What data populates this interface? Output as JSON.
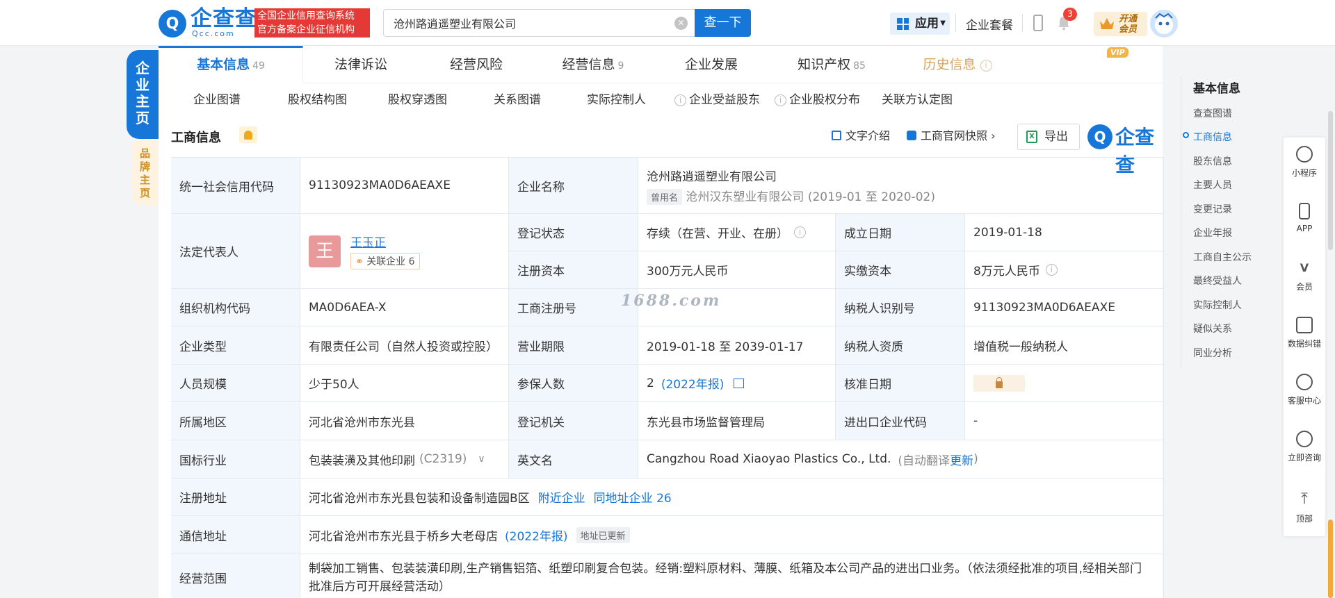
{
  "header": {
    "logo_mark": "Q",
    "logo_name": "企查查",
    "logo_sub": "Qcc.com",
    "slogan_line1": "全国企业信用查询系统",
    "slogan_line2": "官方备案企业征信机构",
    "search_value": "沧州路逍遥塑业有限公司",
    "search_button": "查一下",
    "apps_label": "应用",
    "package_label": "企业套餐",
    "notification_count": "3",
    "vip_line1": "开通",
    "vip_line2": "会员",
    "accent_color": "#1677d8"
  },
  "left_tabs": {
    "main": "企业主页",
    "brand": "品牌主页"
  },
  "tabs": [
    {
      "label": "基本信息",
      "count": "49"
    },
    {
      "label": "法律诉讼",
      "count": ""
    },
    {
      "label": "经营风险",
      "count": ""
    },
    {
      "label": "经营信息",
      "count": "9"
    },
    {
      "label": "企业发展",
      "count": ""
    },
    {
      "label": "知识产权",
      "count": "85"
    },
    {
      "label": "历史信息",
      "count": ""
    }
  ],
  "vip_tag": "VIP",
  "subtabs": [
    "企业图谱",
    "股权结构图",
    "股权穿透图",
    "关系图谱",
    "实际控制人",
    "企业受益股东",
    "企业股权分布",
    "关联方认定图"
  ],
  "section": {
    "title": "工商信息",
    "text_intro": "文字介绍",
    "snapshot": "工商官网快照",
    "export": "导出",
    "brand_text": "企查查"
  },
  "info": {
    "credit_code_label": "统一社会信用代码",
    "credit_code": "91130923MA0D6AEAXE",
    "company_name_label": "企业名称",
    "company_name": "沧州路逍遥塑业有限公司",
    "former_name_tag": "曾用名",
    "former_name": "沧州汉东塑业有限公司",
    "former_period": "(2019-01 至 2020-02)",
    "legal_rep_label": "法定代表人",
    "legal_rep_initial": "王",
    "legal_rep": "王玉正",
    "related_companies": "关联企业 6",
    "reg_status_label": "登记状态",
    "reg_status": "存续（在营、开业、在册）",
    "founded_label": "成立日期",
    "founded": "2019-01-18",
    "reg_capital_label": "注册资本",
    "reg_capital": "300万元人民币",
    "paid_capital_label": "实缴资本",
    "paid_capital": "8万元人民币",
    "org_code_label": "组织机构代码",
    "org_code": "MA0D6AEA-X",
    "biz_reg_no_label": "工商注册号",
    "biz_reg_no": "",
    "taxpayer_id_label": "纳税人识别号",
    "taxpayer_id": "91130923MA0D6AEAXE",
    "company_type_label": "企业类型",
    "company_type": "有限责任公司（自然人投资或控股）",
    "biz_term_label": "营业期限",
    "biz_term": "2019-01-18 至 2039-01-17",
    "tax_qual_label": "纳税人资质",
    "tax_qual": "增值税一般纳税人",
    "staff_size_label": "人员规模",
    "staff_size": "少于50人",
    "insured_label": "参保人数",
    "insured": "2",
    "insured_year": "(2022年报)",
    "approval_label": "核准日期",
    "region_label": "所属地区",
    "region": "河北省沧州市东光县",
    "reg_authority_label": "登记机关",
    "reg_authority": "东光县市场监督管理局",
    "import_export_label": "进出口企业代码",
    "import_export": "-",
    "industry_label": "国标行业",
    "industry": "包装装潢及其他印刷",
    "industry_code": "(C2319)",
    "english_name_label": "英文名",
    "english_name": "Cangzhou Road Xiaoyao Plastics Co., Ltd.",
    "auto_translate": "(自动翻译",
    "update_link": "更新",
    "close_paren": ")",
    "reg_address_label": "注册地址",
    "reg_address": "河北省沧州市东光县包装和设备制造园B区",
    "nearby": "附近企业",
    "same_address": "同地址企业 26",
    "mail_address_label": "通信地址",
    "mail_address": "河北省沧州市东光县于桥乡大老母店",
    "mail_year": "(2022年报)",
    "address_updated": "地址已更新",
    "scope_label": "经营范围",
    "scope": "制袋加工销售、包装装潢印刷,生产销售铝箔、纸塑印刷复合包装。经销:塑料原材料、薄膜、纸箱及本公司产品的进出口业务。（依法须经批准的项目,经相关部门批准后方可开展经营活动）"
  },
  "watermark": "1688.com",
  "right_nav": {
    "title": "基本信息",
    "items": [
      "查查图谱",
      "工商信息",
      "股东信息",
      "主要人员",
      "变更记录",
      "企业年报",
      "工商自主公示",
      "最终受益人",
      "实际控制人",
      "疑似关系",
      "同业分析"
    ]
  },
  "float_tools": [
    "小程序",
    "APP",
    "会员",
    "数据纠错",
    "客服中心",
    "立即咨询",
    "顶部"
  ]
}
